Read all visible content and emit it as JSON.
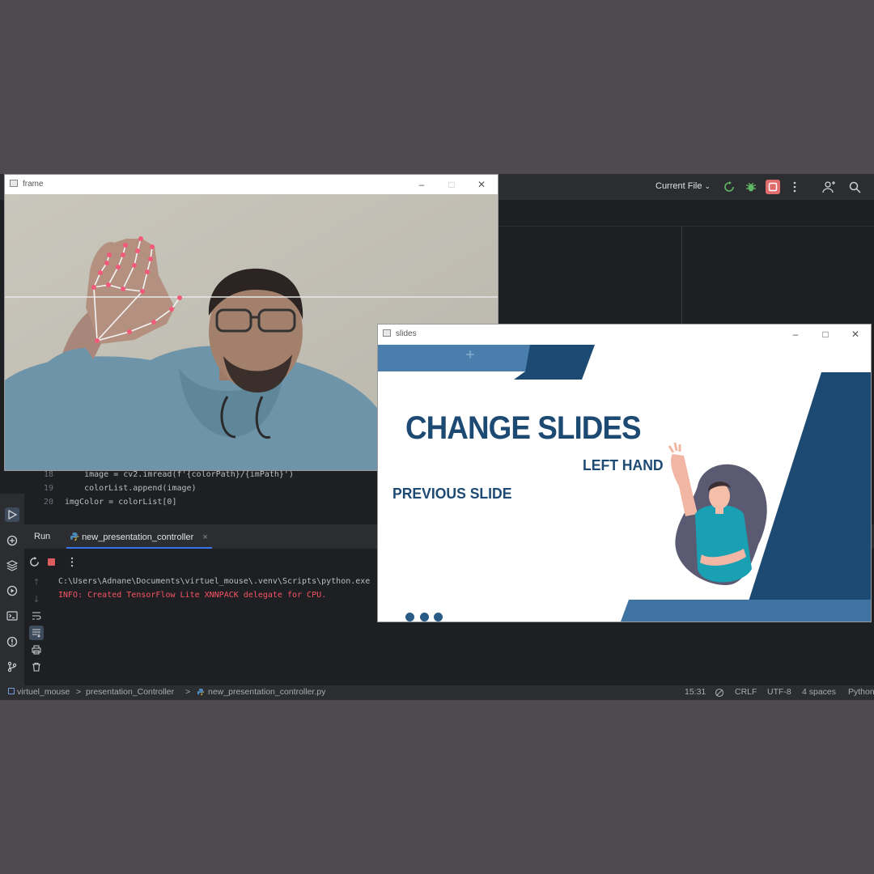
{
  "ide": {
    "toolbar": {
      "run_config": "Current File"
    },
    "code_lines": [
      {
        "number": "18",
        "text": "    image = cv2.imread(f'{colorPath}/{imPath}')"
      },
      {
        "number": "19",
        "text": "    colorList.append(image)"
      },
      {
        "number": "20",
        "text": "imgColor = colorList[0]"
      }
    ],
    "run_panel": {
      "title": "Run",
      "tab_label": "new_presentation_controller",
      "console": [
        {
          "text": "C:\\Users\\Adnane\\Documents\\virtuel_mouse\\.venv\\Scripts\\python.exe",
          "color": "#bcbec4"
        },
        {
          "text": "INFO: Created TensorFlow Lite XNNPACK delegate for CPU.",
          "color": "#f75464"
        }
      ]
    },
    "statusbar": {
      "breadcrumb": [
        "virtuel_mouse",
        "presentation_Controller",
        "new_presentation_controller.py"
      ],
      "separator": ">",
      "position": "15:31",
      "line_ending": "CRLF",
      "encoding": "UTF-8",
      "indent": "4 spaces",
      "language": "Python"
    }
  },
  "frame_window": {
    "title": "frame",
    "icon": "opencv-window-icon"
  },
  "slides_window": {
    "title": "slides",
    "icon": "opencv-window-icon",
    "slide": {
      "title": "CHANGE SLIDES",
      "left_hand_label": "LEFT HAND",
      "previous_label": "PREVIOUS SLIDE",
      "colors": {
        "dark_blue": "#1d4a73",
        "mid_blue": "#2d6496",
        "light_blue": "#4a7fad"
      }
    }
  },
  "colors": {
    "desktop_bg": "#4f4a4e",
    "ide_bg": "#1e1f22",
    "ide_panel": "#2b2d30",
    "accent": "#3574f0",
    "error_red": "#f75464",
    "stop_red": "#e06c6c"
  }
}
